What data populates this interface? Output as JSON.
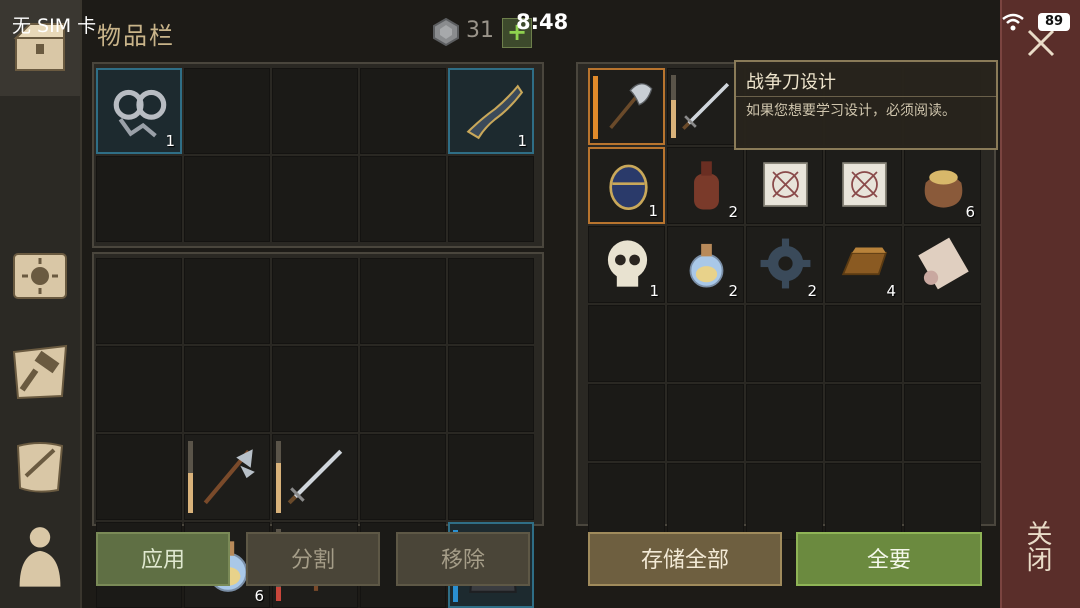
{
  "status_bar": {
    "carrier": "无 SIM 卡",
    "time": "8:48",
    "battery": "89"
  },
  "header": {
    "title": "物品栏",
    "currency_count": "31",
    "add_label": "+"
  },
  "inventory_top": [
    {
      "icon": "shackles-icon",
      "count": "1",
      "selected": "blue"
    },
    {
      "icon": "",
      "count": ""
    },
    {
      "icon": "",
      "count": ""
    },
    {
      "icon": "",
      "count": ""
    },
    {
      "icon": "crossbow-stock-icon",
      "count": "1",
      "selected": "blue"
    },
    {
      "icon": "",
      "count": ""
    },
    {
      "icon": "",
      "count": ""
    },
    {
      "icon": "",
      "count": ""
    },
    {
      "icon": "",
      "count": ""
    },
    {
      "icon": "",
      "count": ""
    }
  ],
  "equipment": [
    {
      "icon": ""
    },
    {
      "icon": ""
    },
    {
      "icon": ""
    },
    {
      "icon": ""
    },
    {
      "icon": ""
    },
    {
      "icon": ""
    },
    {
      "icon": ""
    },
    {
      "icon": ""
    },
    {
      "icon": ""
    },
    {
      "icon": ""
    },
    {
      "icon": ""
    },
    {
      "icon": "halberd-icon",
      "durability": 0.55
    },
    {
      "icon": "sword-icon",
      "durability": 0.7
    },
    {
      "icon": ""
    },
    {
      "icon": ""
    },
    {
      "icon": ""
    },
    {
      "icon": "potion-icon",
      "count": "6"
    },
    {
      "icon": "crossbow-icon",
      "durability": 0.2,
      "dur_color": "red"
    },
    {
      "icon": ""
    },
    {
      "icon": "armor-icon",
      "durability": 1.0,
      "dur_color": "blue",
      "selected": "blue"
    }
  ],
  "storage": [
    {
      "icon": "battle-axe-icon",
      "durability": 1.0,
      "dur_color": "orange",
      "selected": "orange"
    },
    {
      "icon": "sword-icon",
      "durability": 0.6
    },
    {
      "icon": ""
    },
    {
      "icon": ""
    },
    {
      "icon": ""
    },
    {
      "icon": "egg-icon",
      "count": "1",
      "selected": "orange"
    },
    {
      "icon": "bottle-icon",
      "count": "2"
    },
    {
      "icon": "blueprint-icon",
      "count": ""
    },
    {
      "icon": "blueprint-icon",
      "count": ""
    },
    {
      "icon": "sack-icon",
      "count": "6"
    },
    {
      "icon": "skull-icon",
      "count": "1"
    },
    {
      "icon": "potion-icon",
      "count": "2"
    },
    {
      "icon": "gear-icon",
      "count": "2"
    },
    {
      "icon": "ingot-icon",
      "count": "4"
    },
    {
      "icon": "scroll-icon",
      "count": ""
    },
    {
      "icon": ""
    },
    {
      "icon": ""
    },
    {
      "icon": ""
    },
    {
      "icon": ""
    },
    {
      "icon": ""
    },
    {
      "icon": ""
    },
    {
      "icon": ""
    },
    {
      "icon": ""
    },
    {
      "icon": ""
    },
    {
      "icon": ""
    },
    {
      "icon": ""
    },
    {
      "icon": ""
    },
    {
      "icon": ""
    },
    {
      "icon": ""
    },
    {
      "icon": ""
    }
  ],
  "tooltip": {
    "title": "战争刀设计",
    "description": "如果您想要学习设计，必须阅读。"
  },
  "buttons": {
    "apply": "应用",
    "split": "分割",
    "remove": "移除",
    "store_all": "存储全部",
    "take_all": "全要"
  },
  "close_label": "关闭",
  "colors": {
    "accent_green": "#6b8a3f",
    "close_panel": "#5a2e2a",
    "selected_blue": "#2f6e86",
    "selected_orange": "#b8742e"
  }
}
